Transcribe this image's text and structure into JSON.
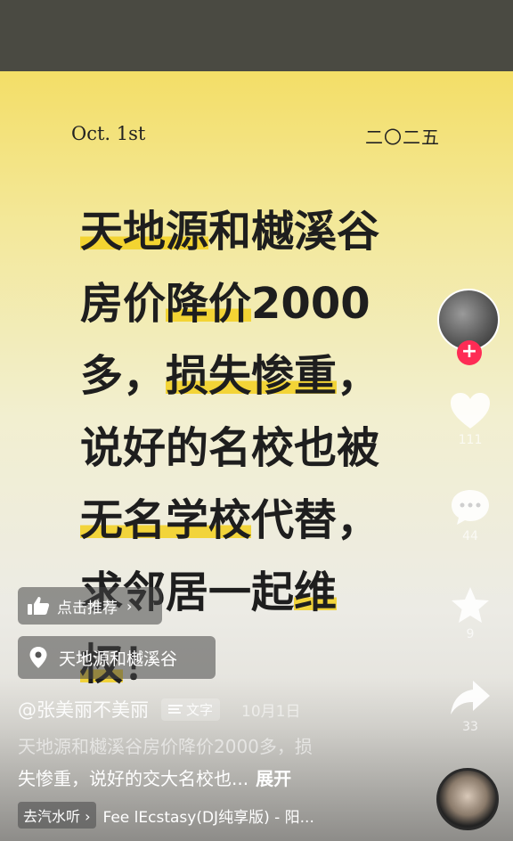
{
  "card": {
    "date_left": "Oct. 1st",
    "date_right": "二〇二五",
    "headline": {
      "line1": [
        "天地源",
        "和樾溪谷"
      ],
      "line2": [
        "房价",
        "降价",
        "2000"
      ],
      "line3": [
        "多，",
        "损失惨重",
        "，"
      ],
      "line4": [
        "说好的名校也被"
      ],
      "line5": [
        "无名学校",
        "代替，"
      ],
      "line6": [
        "求邻居一起",
        "维"
      ],
      "line7": [
        "权",
        "！"
      ]
    }
  },
  "overlay": {
    "recommend_label": "点击推荐",
    "location_label": "天地源和樾溪谷",
    "author_name": "@张美丽不美丽",
    "text_tag": "文字",
    "time_text": "10月1日",
    "caption_faded": "天地源和樾溪谷房价降价2000多，损",
    "caption_main": "失惨重，说好的交大名校也...",
    "expand_label": "展开",
    "music_tag": "去汽水听",
    "music_title": "Fee lEcstasy(DJ纯享版) - 阳..."
  },
  "rail": {
    "like_count": "111",
    "comment_count": "44",
    "favorite_count": "9",
    "share_count": "33"
  },
  "icons": {
    "thumb": "thumbs-up-icon",
    "pin": "location-pin-icon",
    "heart": "heart-icon",
    "comment": "comment-icon",
    "star": "star-icon",
    "share": "share-icon"
  },
  "colors": {
    "highlight": "#f3d01e",
    "follow_button": "#fe2c55"
  }
}
